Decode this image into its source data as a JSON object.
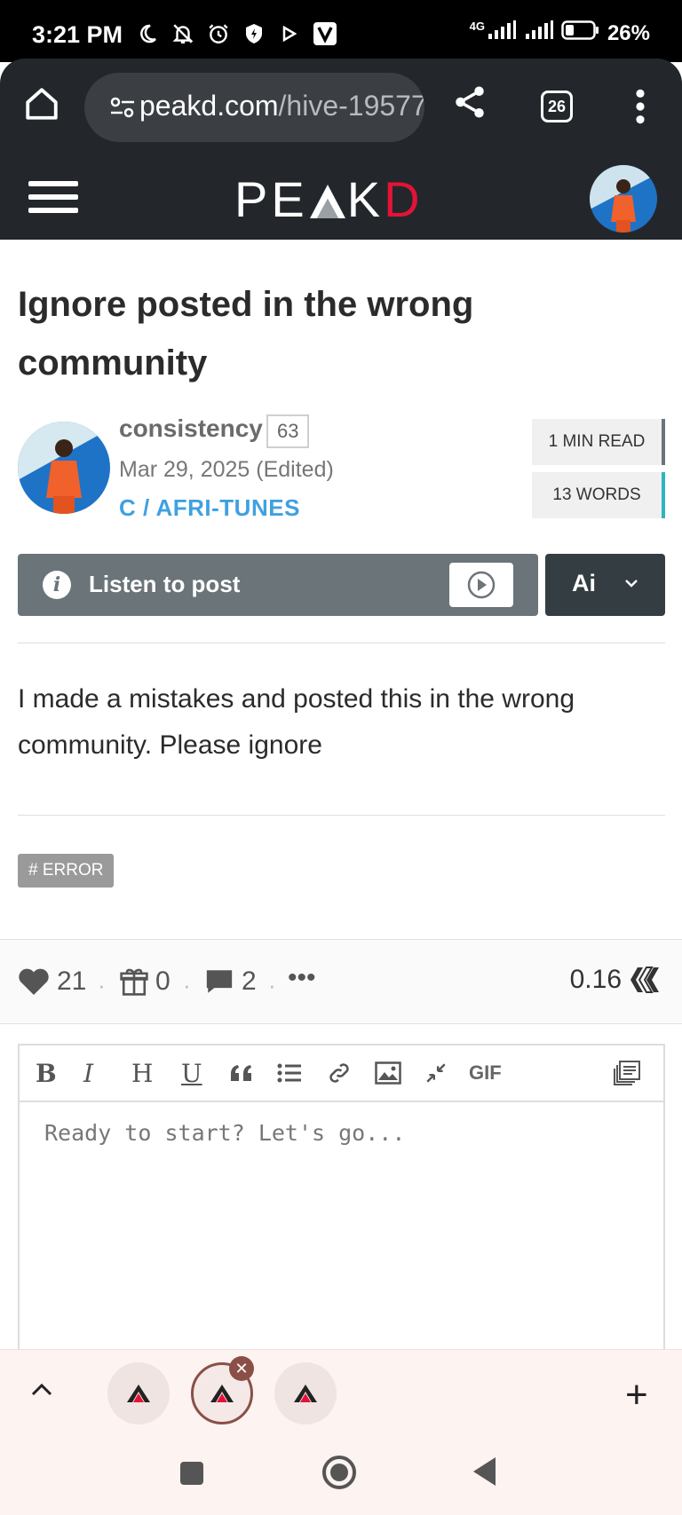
{
  "status_bar": {
    "time": "3:21 PM",
    "network": "4G",
    "battery": "26%",
    "icons": [
      "moon-icon",
      "bell-off-icon",
      "alarm-icon",
      "shield-icon",
      "play-icon",
      "v-app-icon",
      "signal-icon",
      "wifi-signal-icon",
      "battery-icon"
    ]
  },
  "browser": {
    "url_host": "peakd.com",
    "url_path": "/hive-19577",
    "tab_count": "26",
    "icons": [
      "home-icon",
      "site-settings-icon",
      "share-icon",
      "tabs-icon",
      "more-vert-icon"
    ]
  },
  "site": {
    "logo_text_main": "PE",
    "logo_text_a": "A",
    "logo_text_k": "K",
    "logo_text_d": "D",
    "brand_red": "#e31337",
    "header_bg": "#23272b"
  },
  "post": {
    "title": "Ignore posted in the wrong community",
    "author": "consistency",
    "reputation": "63",
    "date": "Mar 29, 2025 (Edited)",
    "community": "C / AFRI-TUNES",
    "read_time": "1 MIN READ",
    "word_count": "13 WORDS",
    "listen_label": "Listen to post",
    "ai_label": "Ai",
    "body": "I made a mistakes and posted this in the wrong community. Please ignore",
    "tag": "# ERROR"
  },
  "actions": {
    "votes": "21",
    "gifts": "0",
    "comments": "2",
    "more": "•••",
    "payout": "0.16"
  },
  "editor": {
    "placeholder": "Ready to start? Let's go...",
    "toolbar": [
      "bold",
      "italic",
      "heading",
      "underline",
      "quote",
      "list",
      "link",
      "image",
      "collapse",
      "gif",
      "templates"
    ],
    "gif_label": "GIF",
    "bold_label": "B",
    "italic_label": "I",
    "heading_label": "H",
    "underline_label": "U"
  },
  "tab_strip": {
    "plus_label": "+"
  }
}
